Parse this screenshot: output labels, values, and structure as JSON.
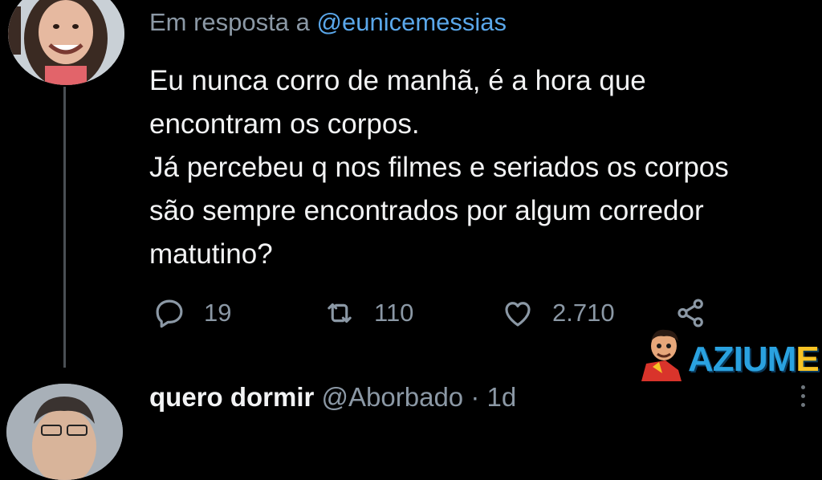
{
  "reply": {
    "prefix": "Em resposta a",
    "mention": "@eunicemessias"
  },
  "tweet": {
    "lines": [
      "Eu nunca corro de manhã, é a hora que",
      "encontram os corpos.",
      "Já percebeu q nos filmes e seriados os corpos",
      "são sempre encontrados por algum corredor",
      "matutino?"
    ]
  },
  "actions": {
    "replies": "19",
    "retweets": "110",
    "likes": "2.710"
  },
  "watermark": {
    "main": "AZIUM",
    "highlight": "E"
  },
  "next_tweet": {
    "name": "quero dormir",
    "handle": "@Aborbado",
    "separator": "·",
    "time": "1d"
  },
  "colors": {
    "background": "#000000",
    "text": "#e7e9ea",
    "muted": "#8b98a5",
    "mention": "#5aa7ea",
    "watermark_blue": "#2aa2e0",
    "watermark_yellow": "#f7c325"
  },
  "icons": [
    "reply-icon",
    "retweet-icon",
    "like-icon",
    "share-icon",
    "more-icon"
  ]
}
